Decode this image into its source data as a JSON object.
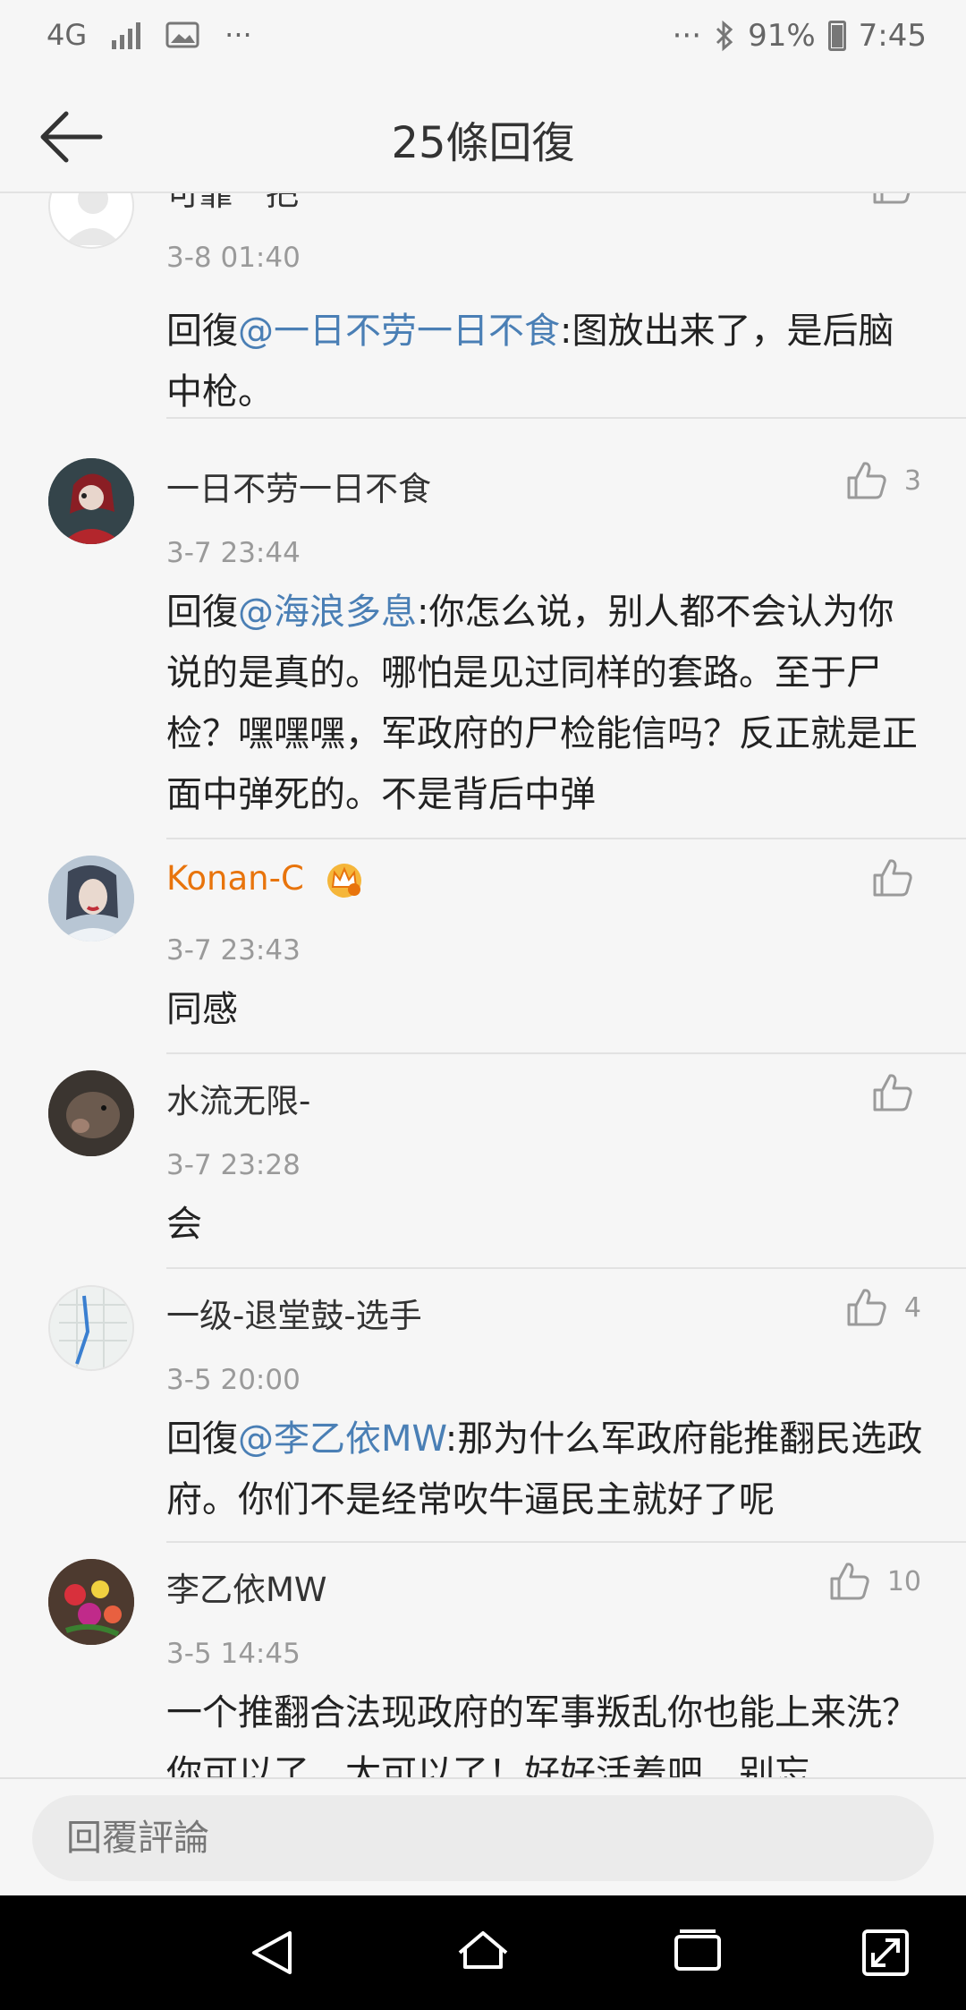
{
  "status_bar": {
    "network": "4G",
    "more": "···",
    "right_more": "···",
    "battery": "91%",
    "time": "7:45"
  },
  "header": {
    "title": "25條回復"
  },
  "comments": [
    {
      "name": "可靠一把",
      "time": "3-8 01:40",
      "reply_prefix": "回復",
      "mention": "@一日不劳一日不食",
      "text": ":图放出来了，是后脑中枪。",
      "likes": ""
    },
    {
      "name": "一日不劳一日不食",
      "time": "3-7 23:44",
      "reply_prefix": "回復",
      "mention": "@海浪多息",
      "text": ":你怎么说，别人都不会认为你说的是真的。哪怕是见过同样的套路。至于尸检？嘿嘿嘿，军政府的尸检能信吗？反正就是正面中弹死的。不是背后中弹",
      "likes": "3"
    },
    {
      "name": "Konan-C",
      "time": "3-7 23:43",
      "text": "同感",
      "likes": ""
    },
    {
      "name": "水流无限-",
      "time": "3-7 23:28",
      "text": "会",
      "likes": ""
    },
    {
      "name": "一级-退堂鼓-选手",
      "time": "3-5 20:00",
      "reply_prefix": "回復",
      "mention": "@李乙依MW",
      "text": ":那为什么军政府能推翻民选政府。你们不是经常吹牛逼民主就好了呢",
      "likes": "4"
    },
    {
      "name": "李乙依MW",
      "time": "3-5 14:45",
      "text": "一个推翻合法现政府的军事叛乱你也能上来洗？你可以了，太可以了！好好活着吧，别忘",
      "likes": "10"
    }
  ],
  "reply_bar": {
    "placeholder": "回覆評論"
  },
  "icons": {
    "back": "arrow-left-icon",
    "like": "thumbs-up-icon",
    "crown": "vip-crown-icon",
    "nav_back": "triangle-back-icon",
    "nav_home": "home-icon",
    "nav_recent": "recent-apps-icon",
    "nav_expand": "expand-icon"
  },
  "colors": {
    "mention": "#4a7fb5",
    "vip_name": "#e8740c",
    "background": "#f6f6f6"
  }
}
